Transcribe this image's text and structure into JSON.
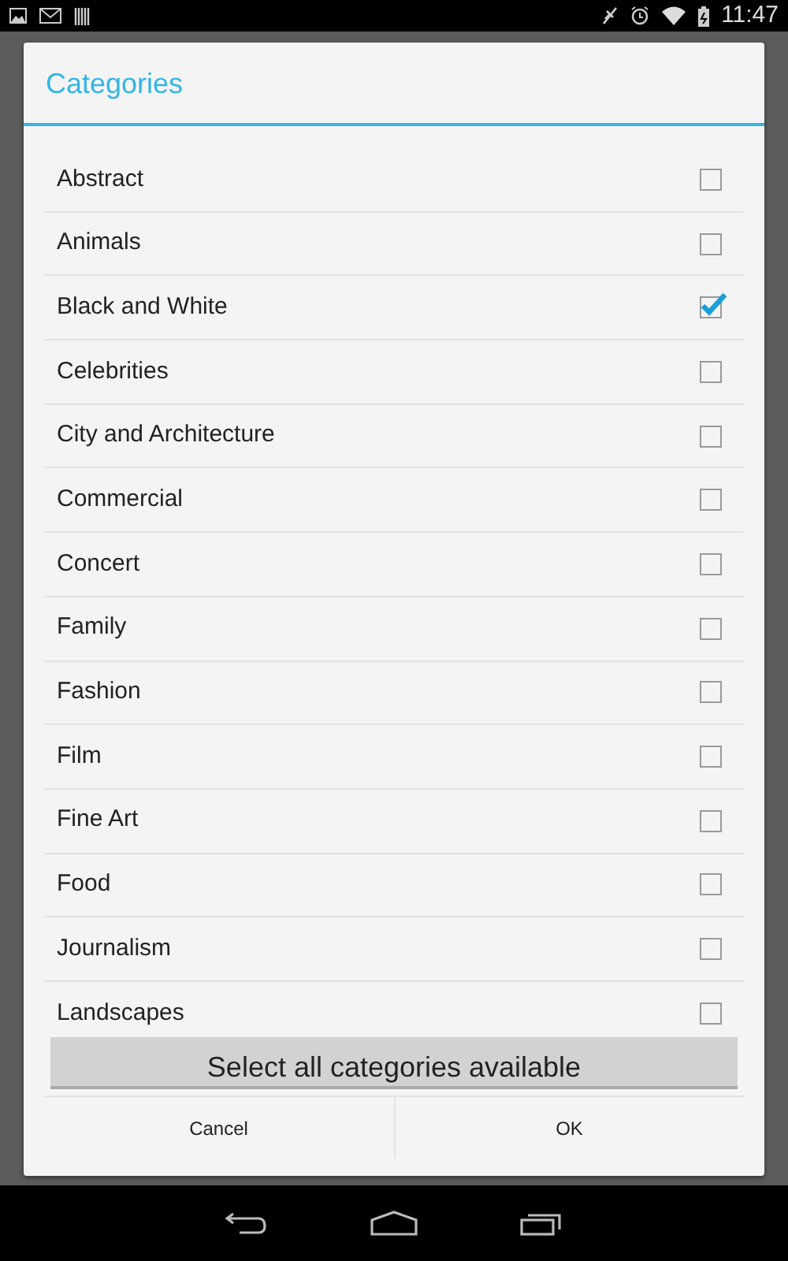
{
  "status_bar": {
    "time": "11:47"
  },
  "dialog": {
    "title": "Categories",
    "items": [
      {
        "label": "Abstract",
        "checked": false
      },
      {
        "label": "Animals",
        "checked": false
      },
      {
        "label": "Black and White",
        "checked": true
      },
      {
        "label": "Celebrities",
        "checked": false
      },
      {
        "label": "City and Architecture",
        "checked": false
      },
      {
        "label": "Commercial",
        "checked": false
      },
      {
        "label": "Concert",
        "checked": false
      },
      {
        "label": "Family",
        "checked": false
      },
      {
        "label": "Fashion",
        "checked": false
      },
      {
        "label": "Film",
        "checked": false
      },
      {
        "label": "Fine Art",
        "checked": false
      },
      {
        "label": "Food",
        "checked": false
      },
      {
        "label": "Journalism",
        "checked": false
      },
      {
        "label": "Landscapes",
        "checked": false
      }
    ],
    "select_all": "Select all categories available",
    "buttons": [
      "Cancel",
      "OK"
    ]
  }
}
